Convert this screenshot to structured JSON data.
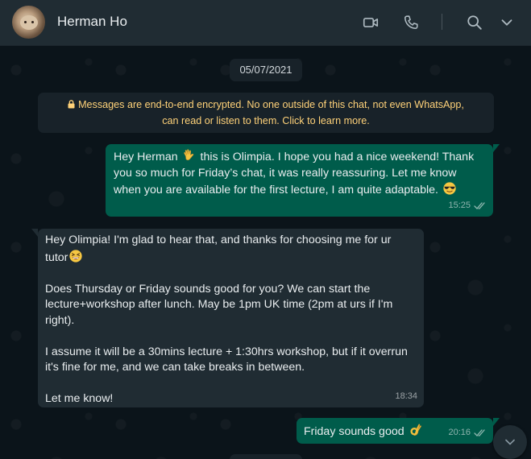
{
  "contact": {
    "name": "Herman Ho"
  },
  "header_icons": [
    "video-call-icon",
    "voice-call-icon",
    "search-icon",
    "chevron-down-icon"
  ],
  "date_chip": "05/07/2021",
  "encryption_notice": {
    "line1": "Messages are end-to-end encrypted. No one outside of this chat, not even WhatsApp,",
    "line2": "can read or listen to them. Click to learn more."
  },
  "messages": [
    {
      "direction": "out",
      "text_before": "Hey Herman ",
      "emoji": "waving-hand",
      "text_after": " this is Olimpia. I hope you had a nice weekend! Thank you so much for Friday’s chat, it was really reassuring. Let me know when you are available for the first lecture, I am quite adaptable. ",
      "emoji2": "sunglasses-face",
      "time": "15:25",
      "status": "read"
    },
    {
      "direction": "in",
      "text_before": "Hey Olimpia! I'm glad to hear that, and thanks for choosing me for ur tutor",
      "emoji": "grinning-squint-face",
      "body": "Does Thursday or Friday sounds good for you? We can start the lecture+workshop after lunch. May be 1pm UK time (2pm at urs if I'm right).\n\nI assume it will be a 30mins lecture + 1:30hrs workshop, but if it overrun it's fine for me, and we can take breaks in between.\n\nLet me know!",
      "time": "18:34"
    },
    {
      "direction": "out",
      "text_before": "Friday sounds good ",
      "emoji": "ok-hand",
      "time": "20:16",
      "status": "read"
    }
  ],
  "colors": {
    "header_bg": "#202c33",
    "chat_bg": "#0b141a",
    "outgoing_bubble": "#005c4b",
    "incoming_bubble": "#202c33",
    "encryption_text": "#ffd279",
    "read_ticks": "#8fb8b0"
  }
}
